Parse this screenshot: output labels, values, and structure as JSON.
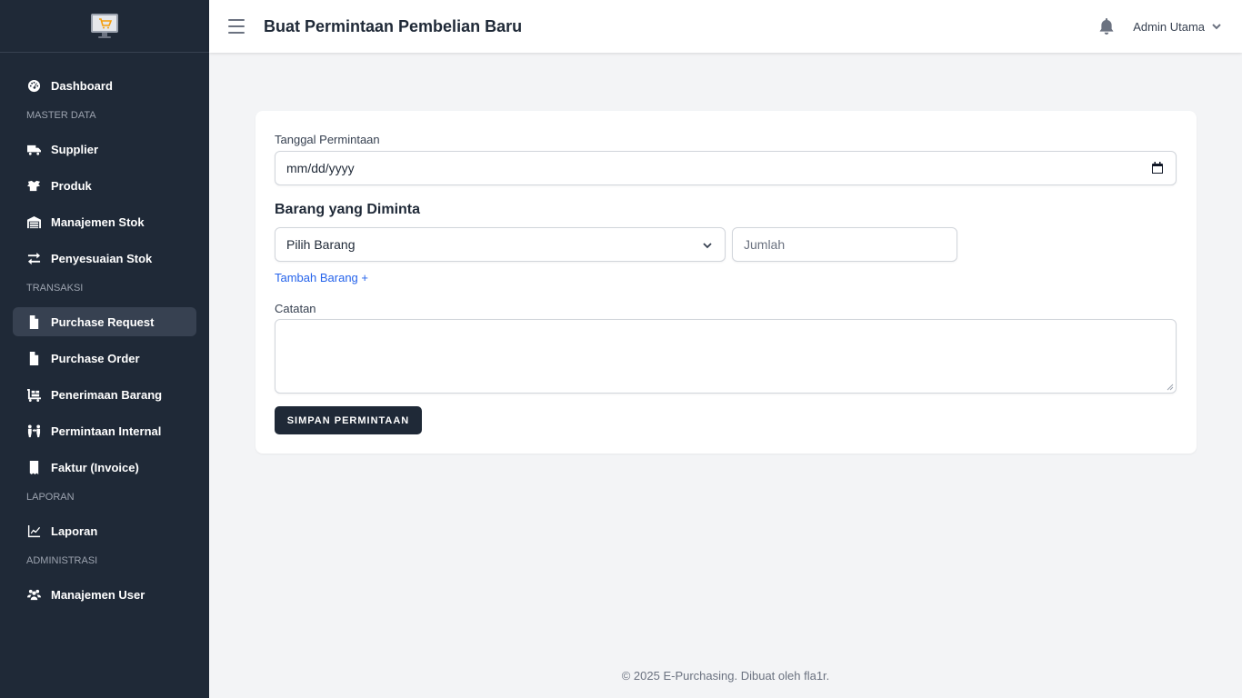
{
  "app": {
    "logo_icon": "monitor-cart-icon",
    "accent": "#f59e0b"
  },
  "sidebar": {
    "items": [
      {
        "label": "Dashboard",
        "icon": "gauge-icon"
      },
      {
        "section": "MASTER DATA"
      },
      {
        "label": "Supplier",
        "icon": "truck-icon"
      },
      {
        "label": "Produk",
        "icon": "box-icon"
      },
      {
        "label": "Manajemen Stok",
        "icon": "warehouse-icon"
      },
      {
        "label": "Penyesuaian Stok",
        "icon": "swap-icon"
      },
      {
        "section": "TRANSAKSI"
      },
      {
        "label": "Purchase Request",
        "icon": "file-icon",
        "active": true
      },
      {
        "label": "Purchase Order",
        "icon": "file-invoice-icon"
      },
      {
        "label": "Penerimaan Barang",
        "icon": "dolly-icon"
      },
      {
        "label": "Permintaan Internal",
        "icon": "people-arrows-icon"
      },
      {
        "label": "Faktur (Invoice)",
        "icon": "receipt-icon"
      },
      {
        "section": "LAPORAN"
      },
      {
        "label": "Laporan",
        "icon": "line-chart-icon"
      },
      {
        "section": "ADMINISTRASI"
      },
      {
        "label": "Manajemen User",
        "icon": "users-icon"
      }
    ]
  },
  "header": {
    "title": "Buat Permintaan Pembelian Baru",
    "user_name": "Admin Utama"
  },
  "form": {
    "date_label": "Tanggal Permintaan",
    "date_placeholder": "mm/dd/yyyy",
    "items_title": "Barang yang Diminta",
    "item_select_value": "Pilih Barang",
    "qty_placeholder": "Jumlah",
    "add_item_link": "Tambah Barang +",
    "notes_label": "Catatan",
    "notes_value": "",
    "submit_label": "SIMPAN PERMINTAAN"
  },
  "footer": {
    "text": "© 2025 E-Purchasing. Dibuat oleh fla1r."
  }
}
